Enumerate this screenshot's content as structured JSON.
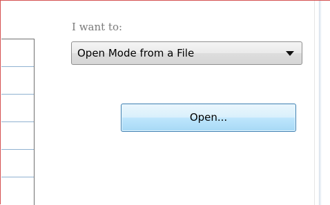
{
  "form": {
    "label": "I want to:",
    "dropdown": {
      "selected": "Open Mode from a File"
    },
    "open_button_label": "Open..."
  },
  "list_panel": {
    "row_count": 6
  },
  "colors": {
    "window_border": "#d45050",
    "button_border": "#3c7fb1",
    "button_fill": "#bee6fd",
    "list_divider": "#8fb1d0"
  }
}
